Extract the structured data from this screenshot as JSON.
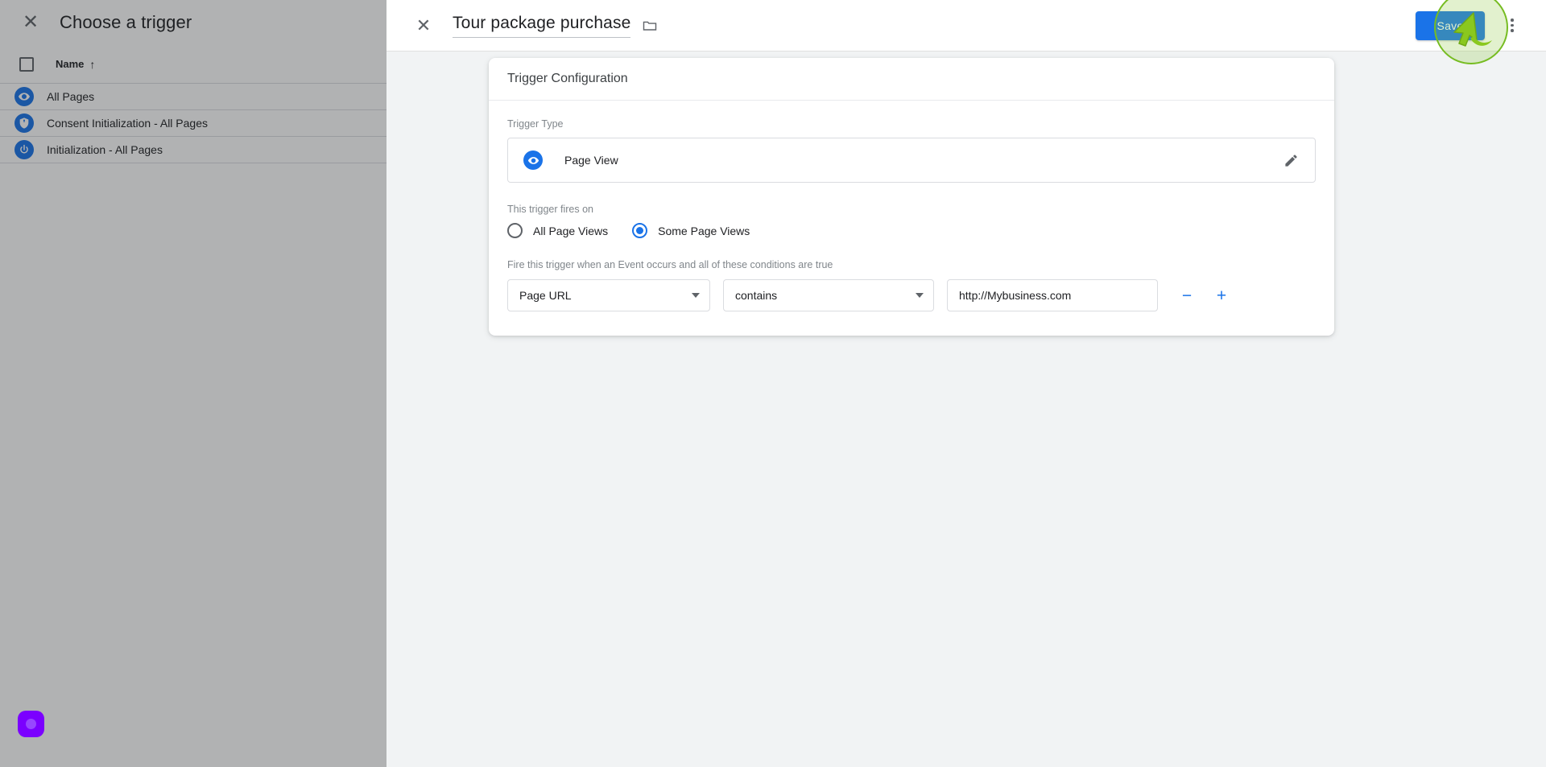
{
  "background_panel": {
    "close_icon": "close-icon",
    "title": "Choose a trigger",
    "table": {
      "select_all_checkbox": "checkbox-unchecked",
      "column_name": "Name",
      "sort_arrow": "↑",
      "rows": [
        {
          "icon": "eye-icon",
          "label": "All Pages"
        },
        {
          "icon": "shield-icon",
          "label": "Consent Initialization - All Pages"
        },
        {
          "icon": "power-icon",
          "label": "Initialization - All Pages"
        }
      ]
    },
    "fab": {
      "icon": "circle-icon",
      "color": "#7b00ff"
    }
  },
  "modal": {
    "header": {
      "close_icon": "close-icon",
      "title": "Tour package purchase",
      "folder_icon": "folder-icon",
      "save_label": "Save",
      "more_menu_icon": "more-vert-icon"
    },
    "card": {
      "header_title": "Trigger Configuration",
      "trigger_type": {
        "label": "Trigger Type",
        "icon": "page-view-icon",
        "value": "Page View",
        "edit_icon": "pencil-icon"
      },
      "fires_on": {
        "label": "This trigger fires on",
        "options": [
          {
            "label": "All Page Views",
            "selected": false
          },
          {
            "label": "Some Page Views",
            "selected": true
          }
        ]
      },
      "conditions": {
        "hint": "Fire this trigger when an Event occurs and all of these conditions are true",
        "variable": "Page URL",
        "operator": "contains",
        "value": "http://Mybusiness.com",
        "remove_label": "−",
        "add_label": "+"
      }
    }
  },
  "annotation": {
    "highlight_color": "#76bc21",
    "cursor_icon": "arrow-cursor-icon"
  }
}
